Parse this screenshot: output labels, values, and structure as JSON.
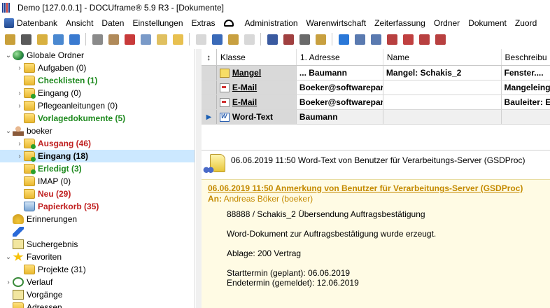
{
  "window": {
    "title": "Demo [127.0.0.1] - DOCUframe® 5.9 R3 - [Dokumente]"
  },
  "menu": {
    "items": [
      "Datenbank",
      "Ansicht",
      "Daten",
      "Einstellungen",
      "Extras",
      "",
      "Administration",
      "Warenwirtschaft",
      "Zeiterfassung",
      "Ordner",
      "Dokument",
      "Zuord"
    ]
  },
  "toolbar": {
    "colors": [
      "#c9a03a",
      "#5a5a5a",
      "#d8b040",
      "#4a88d0",
      "#3a7ad0",
      "#8a8a8a",
      "#b08a5a",
      "#c83a3a",
      "#7a9ac8",
      "#e0c060",
      "#e8c050",
      "#d8d8d8",
      "#3a6ab8",
      "#c8a040",
      "#d8d8d8",
      "#3a5aa0",
      "#a04040",
      "#6a6a6a",
      "#c8a040",
      "#2a78d8",
      "#5a7ab0",
      "#5a7ab0",
      "#b84040",
      "#c04040",
      "#b84040",
      "#b84040"
    ]
  },
  "tree": {
    "items": [
      {
        "label": "Globale Ordner",
        "icon": "globe-icon",
        "style": "normal",
        "level": 0,
        "chev": "⌄"
      },
      {
        "label": "Aufgaben (0)",
        "icon": "folder-icon",
        "style": "normal",
        "level": 1,
        "chev": "›"
      },
      {
        "label": "Checklisten (1)",
        "icon": "folder-icon",
        "style": "green",
        "level": 1,
        "chev": ""
      },
      {
        "label": "Eingang (0)",
        "icon": "inbox-folder-icon",
        "style": "normal",
        "level": 1,
        "chev": "›"
      },
      {
        "label": "Pflegeanleitungen (0)",
        "icon": "folder-icon",
        "style": "normal",
        "level": 1,
        "chev": "›"
      },
      {
        "label": "Vorlagedokumente (5)",
        "icon": "folder-icon",
        "style": "green",
        "level": 1,
        "chev": ""
      },
      {
        "label": "boeker",
        "icon": "user-icon",
        "style": "normal",
        "level": 0,
        "chev": "⌄"
      },
      {
        "label": "Ausgang (46)",
        "icon": "outbox-folder-icon",
        "style": "red",
        "level": 1,
        "chev": "›"
      },
      {
        "label": "Eingang (18)",
        "icon": "inbox-folder-icon",
        "style": "bold",
        "level": 1,
        "chev": "›",
        "selected": true
      },
      {
        "label": "Erledigt (3)",
        "icon": "done-folder-icon",
        "style": "green",
        "level": 1,
        "chev": ""
      },
      {
        "label": "IMAP (0)",
        "icon": "folder-icon",
        "style": "normal",
        "level": 1,
        "chev": ""
      },
      {
        "label": "Neu (29)",
        "icon": "folder-icon",
        "style": "red",
        "level": 1,
        "chev": ""
      },
      {
        "label": "Papierkorb (35)",
        "icon": "trash-icon",
        "style": "red",
        "level": 1,
        "chev": ""
      },
      {
        "label": "Erinnerungen",
        "icon": "bell-icon",
        "style": "normal",
        "level": 0,
        "chev": ""
      },
      {
        "label": "",
        "icon": "pin-icon",
        "style": "normal",
        "level": 0,
        "chev": ""
      },
      {
        "label": "Suchergebnis",
        "icon": "search-result-icon",
        "style": "normal",
        "level": 0,
        "chev": ""
      },
      {
        "label": "Favoriten",
        "icon": "star-icon",
        "style": "normal",
        "level": 0,
        "chev": "⌄"
      },
      {
        "label": "Projekte (31)",
        "icon": "folder-icon",
        "style": "normal",
        "level": 1,
        "chev": ""
      },
      {
        "label": "Verlauf",
        "icon": "history-icon",
        "style": "normal",
        "level": 0,
        "chev": "›"
      },
      {
        "label": "Vorgänge",
        "icon": "task-icon",
        "style": "normal",
        "level": 0,
        "chev": ""
      },
      {
        "label": "Adressen",
        "icon": "folder-icon",
        "style": "normal",
        "level": 0,
        "chev": ""
      }
    ]
  },
  "grid": {
    "sort_glyph": "↕",
    "columns": [
      "Klasse",
      "1. Adresse",
      "Name",
      "Beschreibu"
    ],
    "rows": [
      {
        "klasse": "Mangel",
        "klasse_icon": "mangel",
        "adresse": "... Baumann",
        "name": "Mangel: Schakis_2",
        "beschreibung": "Fenster....",
        "pointer": ""
      },
      {
        "klasse": "E-Mail",
        "klasse_icon": "mail",
        "adresse": "Boeker@softwarepar",
        "name": "",
        "beschreibung": "Mangeleing",
        "pointer": ""
      },
      {
        "klasse": "E-Mail",
        "klasse_icon": "mail",
        "adresse": "Boeker@softwarepar",
        "name": "",
        "beschreibung": "Bauleiter: E",
        "pointer": ""
      },
      {
        "klasse": "Word-Text",
        "klasse_icon": "word",
        "adresse": "Baumann",
        "name": "",
        "beschreibung": "",
        "pointer": "▶"
      }
    ]
  },
  "detail": {
    "header": "06.06.2019 11:50 Word-Text  von Benutzer für Verarbeitungs-Server (GSDProc)",
    "title": "06.06.2019 11:50 Anmerkung von Benutzer für Verarbeitungs-Server (GSDProc)",
    "from_label": "An:",
    "from_value": "Andreas Böker (boeker)",
    "lines": [
      "88888 / Schakis_2 Übersendung Auftragsbestätigung",
      "",
      "Word-Dokument zur Auftragsbestätigung wurde erzeugt.",
      "",
      "Ablage: 200 Vertrag",
      "",
      "Starttermin (geplant): 06.06.2019",
      "Endetermin (gemeldet): 12.06.2019"
    ]
  }
}
